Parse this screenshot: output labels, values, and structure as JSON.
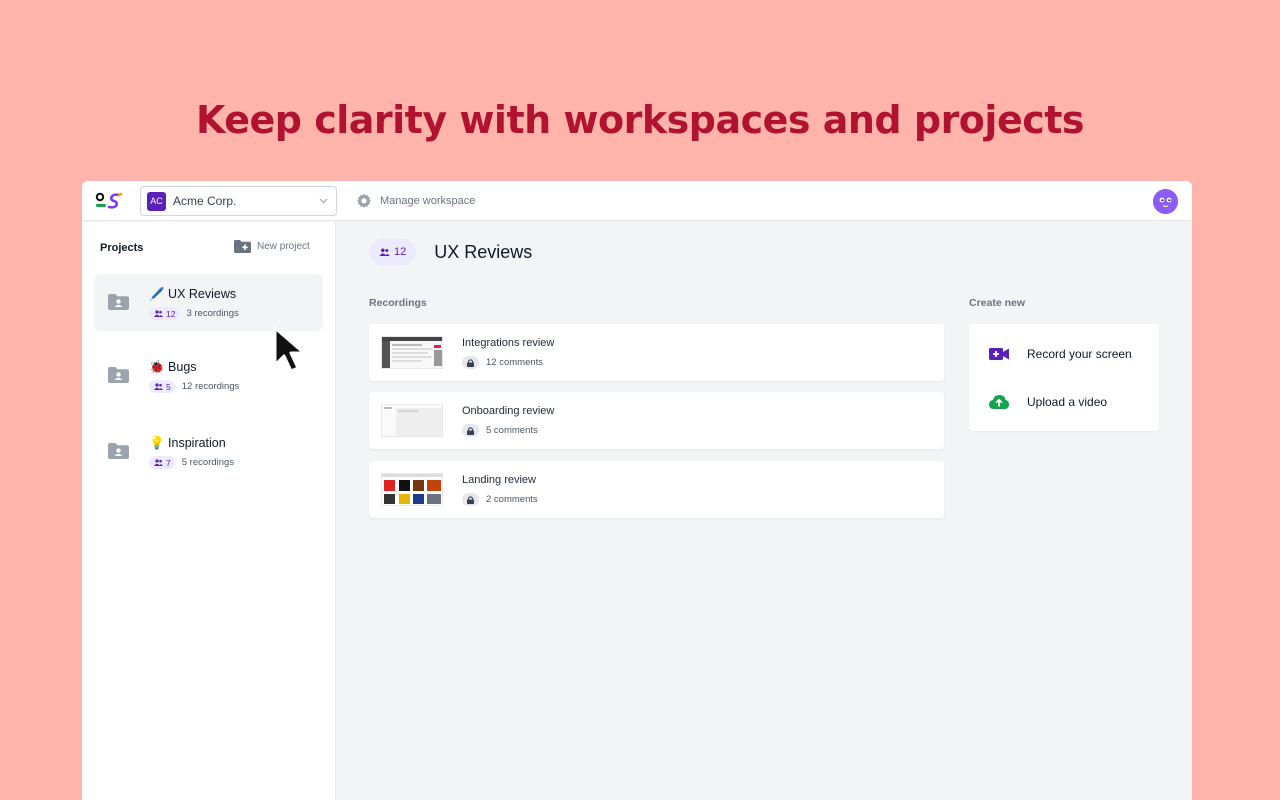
{
  "headline": "Keep clarity with workspaces and projects",
  "topbar": {
    "workspace_badge": "AC",
    "workspace_name": "Acme Corp.",
    "manage_label": "Manage workspace"
  },
  "sidebar": {
    "title": "Projects",
    "new_project_label": "New project",
    "projects": [
      {
        "name": "🖊️ UX Reviews",
        "members": "12",
        "recordings": "3 recordings",
        "active": true
      },
      {
        "name": "🐞 Bugs",
        "members": "5",
        "recordings": "12 recordings",
        "active": false
      },
      {
        "name": "💡 Inspiration",
        "members": "7",
        "recordings": "5 recordings",
        "active": false
      }
    ]
  },
  "main": {
    "members": "12",
    "title": "UX Reviews",
    "recordings_label": "Recordings",
    "recordings": [
      {
        "title": "Integrations review",
        "comments": "12 comments"
      },
      {
        "title": "Onboarding review",
        "comments": "5 comments"
      },
      {
        "title": "Landing review",
        "comments": "2 comments"
      }
    ],
    "create_label": "Create new",
    "create_items": [
      {
        "label": "Record your screen",
        "icon": "video-plus-icon"
      },
      {
        "label": "Upload a video",
        "icon": "cloud-upload-icon"
      }
    ]
  },
  "colors": {
    "background": "#ffb4ab",
    "headline": "#b0122f",
    "accent": "#5b21b6",
    "upload": "#16a34a"
  }
}
